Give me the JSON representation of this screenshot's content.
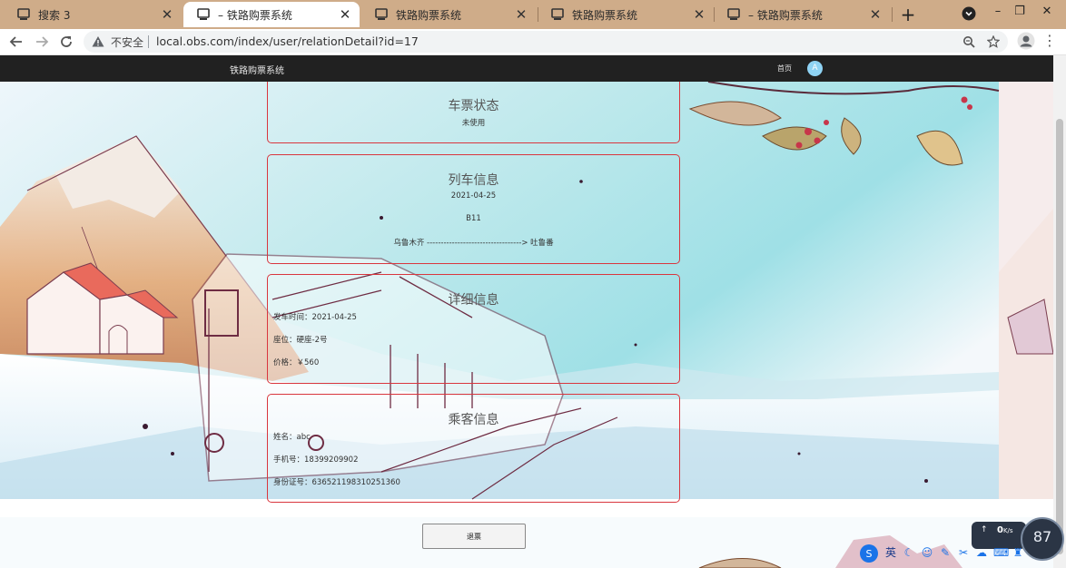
{
  "browser": {
    "tabs": [
      {
        "label": "搜索 3",
        "active": false
      },
      {
        "label": "– 铁路购票系统",
        "active": true
      },
      {
        "label": "铁路购票系统",
        "active": false
      },
      {
        "label": "铁路购票系统",
        "active": false
      },
      {
        "label": "– 铁路购票系统",
        "active": false
      }
    ],
    "close_glyph": "✕",
    "new_tab_glyph": "+",
    "window_controls": {
      "minimize": "–",
      "restore": "❐",
      "close": "✕"
    },
    "security_label": "不安全",
    "url": "local.obs.com/index/user/relationDetail?id=17"
  },
  "navbar": {
    "brand": "铁路购票系统",
    "home_link": "首页",
    "avatar_letter": "A"
  },
  "ticket_status": {
    "title": "车票状态",
    "status": "未使用"
  },
  "train_info": {
    "title": "列车信息",
    "date": "2021-04-25",
    "train_no": "B11",
    "route": "乌鲁木齐 ----------------------------------> 吐鲁番"
  },
  "detail_info": {
    "title": "详细信息",
    "departure_label": "发车时间：",
    "departure_value": "2021-04-25",
    "seat_label": "座位：",
    "seat_value": "硬座-2号",
    "price_label": "价格：",
    "price_value": "￥560"
  },
  "passenger_info": {
    "title": "乘客信息",
    "name_label": "姓名：",
    "name_value": "abc",
    "phone_label": "手机号：",
    "phone_value": "18399209902",
    "id_label": "身份证号：",
    "id_value": "636521198310251360"
  },
  "actions": {
    "refund_label": "退票"
  },
  "tray": {
    "network_speed": "0",
    "network_unit": "K/s",
    "gauge_value": "87",
    "ime_label": "英"
  },
  "colors": {
    "tab_strip": "#cfac89",
    "navbar": "#212121",
    "card_border": "#d9363e",
    "avatar": "#8fd3f4"
  },
  "icons": {
    "tab": "monitor-icon",
    "warning": "warning-triangle-icon",
    "zoom": "magnify-icon",
    "bookmark": "star-icon",
    "profile": "person-icon"
  }
}
